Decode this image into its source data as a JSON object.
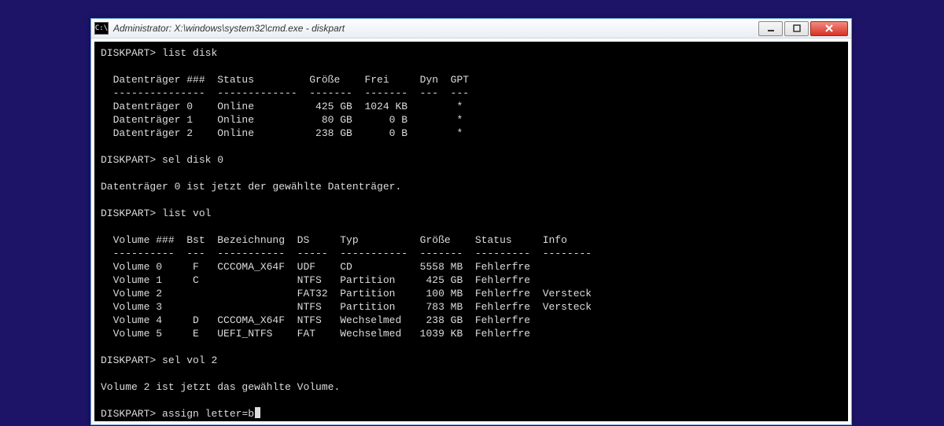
{
  "window": {
    "title": "Administrator: X:\\windows\\system32\\cmd.exe - diskpart",
    "icon_label": "C:\\"
  },
  "prompts": {
    "p1": "DISKPART>",
    "cmd1": "list disk",
    "cmd2": "sel disk 0",
    "cmd3": "list vol",
    "cmd4": "sel vol 2",
    "cmd5": "assign letter=b"
  },
  "disk_table": {
    "header": "  Datenträger ###  Status         Größe    Frei     Dyn  GPT",
    "rule": "  ---------------  -------------  -------  -------  ---  ---",
    "rows": [
      "  Datenträger 0    Online          425 GB  1024 KB        *",
      "  Datenträger 1    Online           80 GB      0 B        *",
      "  Datenträger 2    Online          238 GB      0 B        *"
    ]
  },
  "messages": {
    "disk_selected": "Datenträger 0 ist jetzt der gewählte Datenträger.",
    "vol_selected": "Volume 2 ist jetzt das gewählte Volume."
  },
  "vol_table": {
    "header": "  Volume ###  Bst  Bezeichnung  DS     Typ          Größe    Status     Info",
    "rule": "  ----------  ---  -----------  -----  -----------  -------  ---------  --------",
    "rows": [
      "  Volume 0     F   CCCOMA_X64F  UDF    CD           5558 MB  Fehlerfre",
      "  Volume 1     C                NTFS   Partition     425 GB  Fehlerfre",
      "  Volume 2                      FAT32  Partition     100 MB  Fehlerfre  Versteck",
      "  Volume 3                      NTFS   Partition     783 MB  Fehlerfre  Versteck",
      "  Volume 4     D   CCCOMA_X64F  NTFS   Wechselmed    238 GB  Fehlerfre",
      "  Volume 5     E   UEFI_NTFS    FAT    Wechselmed   1039 KB  Fehlerfre"
    ]
  }
}
